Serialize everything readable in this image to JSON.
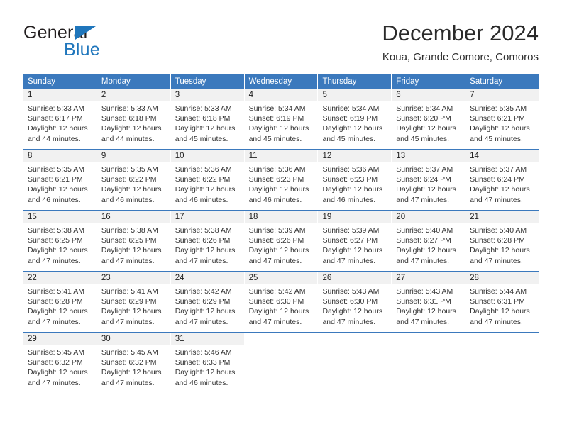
{
  "brand": {
    "name_top": "General",
    "name_bottom": "Blue",
    "triangle_icon": "triangle-icon",
    "accent_color": "#1f76bc"
  },
  "header": {
    "title": "December 2024",
    "subtitle": "Koua, Grande Comore, Comoros"
  },
  "colors": {
    "header_blue": "#3b79bd",
    "daynum_gray": "#f1f1f1",
    "text": "#333333"
  },
  "weekdays": [
    "Sunday",
    "Monday",
    "Tuesday",
    "Wednesday",
    "Thursday",
    "Friday",
    "Saturday"
  ],
  "labels": {
    "sunrise_prefix": "Sunrise:",
    "sunset_prefix": "Sunset:",
    "daylight_prefix": "Daylight:"
  },
  "weeks": [
    [
      {
        "day": "1",
        "sunrise": "Sunrise: 5:33 AM",
        "sunset": "Sunset: 6:17 PM",
        "daylight_1": "Daylight: 12 hours",
        "daylight_2": "and 44 minutes."
      },
      {
        "day": "2",
        "sunrise": "Sunrise: 5:33 AM",
        "sunset": "Sunset: 6:18 PM",
        "daylight_1": "Daylight: 12 hours",
        "daylight_2": "and 44 minutes."
      },
      {
        "day": "3",
        "sunrise": "Sunrise: 5:33 AM",
        "sunset": "Sunset: 6:18 PM",
        "daylight_1": "Daylight: 12 hours",
        "daylight_2": "and 45 minutes."
      },
      {
        "day": "4",
        "sunrise": "Sunrise: 5:34 AM",
        "sunset": "Sunset: 6:19 PM",
        "daylight_1": "Daylight: 12 hours",
        "daylight_2": "and 45 minutes."
      },
      {
        "day": "5",
        "sunrise": "Sunrise: 5:34 AM",
        "sunset": "Sunset: 6:19 PM",
        "daylight_1": "Daylight: 12 hours",
        "daylight_2": "and 45 minutes."
      },
      {
        "day": "6",
        "sunrise": "Sunrise: 5:34 AM",
        "sunset": "Sunset: 6:20 PM",
        "daylight_1": "Daylight: 12 hours",
        "daylight_2": "and 45 minutes."
      },
      {
        "day": "7",
        "sunrise": "Sunrise: 5:35 AM",
        "sunset": "Sunset: 6:21 PM",
        "daylight_1": "Daylight: 12 hours",
        "daylight_2": "and 45 minutes."
      }
    ],
    [
      {
        "day": "8",
        "sunrise": "Sunrise: 5:35 AM",
        "sunset": "Sunset: 6:21 PM",
        "daylight_1": "Daylight: 12 hours",
        "daylight_2": "and 46 minutes."
      },
      {
        "day": "9",
        "sunrise": "Sunrise: 5:35 AM",
        "sunset": "Sunset: 6:22 PM",
        "daylight_1": "Daylight: 12 hours",
        "daylight_2": "and 46 minutes."
      },
      {
        "day": "10",
        "sunrise": "Sunrise: 5:36 AM",
        "sunset": "Sunset: 6:22 PM",
        "daylight_1": "Daylight: 12 hours",
        "daylight_2": "and 46 minutes."
      },
      {
        "day": "11",
        "sunrise": "Sunrise: 5:36 AM",
        "sunset": "Sunset: 6:23 PM",
        "daylight_1": "Daylight: 12 hours",
        "daylight_2": "and 46 minutes."
      },
      {
        "day": "12",
        "sunrise": "Sunrise: 5:36 AM",
        "sunset": "Sunset: 6:23 PM",
        "daylight_1": "Daylight: 12 hours",
        "daylight_2": "and 46 minutes."
      },
      {
        "day": "13",
        "sunrise": "Sunrise: 5:37 AM",
        "sunset": "Sunset: 6:24 PM",
        "daylight_1": "Daylight: 12 hours",
        "daylight_2": "and 47 minutes."
      },
      {
        "day": "14",
        "sunrise": "Sunrise: 5:37 AM",
        "sunset": "Sunset: 6:24 PM",
        "daylight_1": "Daylight: 12 hours",
        "daylight_2": "and 47 minutes."
      }
    ],
    [
      {
        "day": "15",
        "sunrise": "Sunrise: 5:38 AM",
        "sunset": "Sunset: 6:25 PM",
        "daylight_1": "Daylight: 12 hours",
        "daylight_2": "and 47 minutes."
      },
      {
        "day": "16",
        "sunrise": "Sunrise: 5:38 AM",
        "sunset": "Sunset: 6:25 PM",
        "daylight_1": "Daylight: 12 hours",
        "daylight_2": "and 47 minutes."
      },
      {
        "day": "17",
        "sunrise": "Sunrise: 5:38 AM",
        "sunset": "Sunset: 6:26 PM",
        "daylight_1": "Daylight: 12 hours",
        "daylight_2": "and 47 minutes."
      },
      {
        "day": "18",
        "sunrise": "Sunrise: 5:39 AM",
        "sunset": "Sunset: 6:26 PM",
        "daylight_1": "Daylight: 12 hours",
        "daylight_2": "and 47 minutes."
      },
      {
        "day": "19",
        "sunrise": "Sunrise: 5:39 AM",
        "sunset": "Sunset: 6:27 PM",
        "daylight_1": "Daylight: 12 hours",
        "daylight_2": "and 47 minutes."
      },
      {
        "day": "20",
        "sunrise": "Sunrise: 5:40 AM",
        "sunset": "Sunset: 6:27 PM",
        "daylight_1": "Daylight: 12 hours",
        "daylight_2": "and 47 minutes."
      },
      {
        "day": "21",
        "sunrise": "Sunrise: 5:40 AM",
        "sunset": "Sunset: 6:28 PM",
        "daylight_1": "Daylight: 12 hours",
        "daylight_2": "and 47 minutes."
      }
    ],
    [
      {
        "day": "22",
        "sunrise": "Sunrise: 5:41 AM",
        "sunset": "Sunset: 6:28 PM",
        "daylight_1": "Daylight: 12 hours",
        "daylight_2": "and 47 minutes."
      },
      {
        "day": "23",
        "sunrise": "Sunrise: 5:41 AM",
        "sunset": "Sunset: 6:29 PM",
        "daylight_1": "Daylight: 12 hours",
        "daylight_2": "and 47 minutes."
      },
      {
        "day": "24",
        "sunrise": "Sunrise: 5:42 AM",
        "sunset": "Sunset: 6:29 PM",
        "daylight_1": "Daylight: 12 hours",
        "daylight_2": "and 47 minutes."
      },
      {
        "day": "25",
        "sunrise": "Sunrise: 5:42 AM",
        "sunset": "Sunset: 6:30 PM",
        "daylight_1": "Daylight: 12 hours",
        "daylight_2": "and 47 minutes."
      },
      {
        "day": "26",
        "sunrise": "Sunrise: 5:43 AM",
        "sunset": "Sunset: 6:30 PM",
        "daylight_1": "Daylight: 12 hours",
        "daylight_2": "and 47 minutes."
      },
      {
        "day": "27",
        "sunrise": "Sunrise: 5:43 AM",
        "sunset": "Sunset: 6:31 PM",
        "daylight_1": "Daylight: 12 hours",
        "daylight_2": "and 47 minutes."
      },
      {
        "day": "28",
        "sunrise": "Sunrise: 5:44 AM",
        "sunset": "Sunset: 6:31 PM",
        "daylight_1": "Daylight: 12 hours",
        "daylight_2": "and 47 minutes."
      }
    ],
    [
      {
        "day": "29",
        "sunrise": "Sunrise: 5:45 AM",
        "sunset": "Sunset: 6:32 PM",
        "daylight_1": "Daylight: 12 hours",
        "daylight_2": "and 47 minutes."
      },
      {
        "day": "30",
        "sunrise": "Sunrise: 5:45 AM",
        "sunset": "Sunset: 6:32 PM",
        "daylight_1": "Daylight: 12 hours",
        "daylight_2": "and 47 minutes."
      },
      {
        "day": "31",
        "sunrise": "Sunrise: 5:46 AM",
        "sunset": "Sunset: 6:33 PM",
        "daylight_1": "Daylight: 12 hours",
        "daylight_2": "and 46 minutes."
      },
      {
        "day": "",
        "sunrise": "",
        "sunset": "",
        "daylight_1": "",
        "daylight_2": ""
      },
      {
        "day": "",
        "sunrise": "",
        "sunset": "",
        "daylight_1": "",
        "daylight_2": ""
      },
      {
        "day": "",
        "sunrise": "",
        "sunset": "",
        "daylight_1": "",
        "daylight_2": ""
      },
      {
        "day": "",
        "sunrise": "",
        "sunset": "",
        "daylight_1": "",
        "daylight_2": ""
      }
    ]
  ]
}
